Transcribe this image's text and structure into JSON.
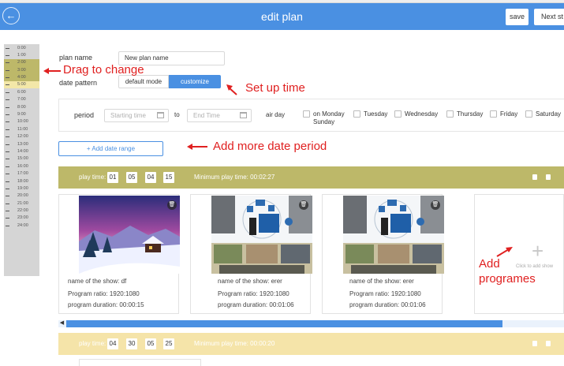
{
  "header": {
    "title": "edit plan",
    "save_label": "save",
    "next_label": "Next st"
  },
  "timeline": {
    "hours": [
      "0:00",
      "1:00",
      "2:00",
      "3:00",
      "4:00",
      "5:00",
      "6:00",
      "7:00",
      "8:00",
      "9:00",
      "10:00",
      "11:00",
      "12:00",
      "13:00",
      "14:00",
      "15:00",
      "16:00",
      "17:00",
      "18:00",
      "19:00",
      "20:00",
      "21:00",
      "22:00",
      "23:00",
      "24:00"
    ],
    "selected_range": "2:00-4:00",
    "current_hour": "5:00"
  },
  "form": {
    "plan_name_label": "plan name",
    "plan_name_value": "New plan name",
    "date_pattern_label": "date pattern",
    "default_mode_label": "default mode",
    "customize_label": "customize",
    "period_label": "period",
    "start_placeholder": "Starting time",
    "to_label": "to",
    "end_placeholder": "End Time",
    "air_day_label": "air day",
    "days": [
      "on Monday",
      "Sunday",
      "Tuesday",
      "Wednesday",
      "Thursday",
      "Friday",
      "Saturday"
    ],
    "add_date_range_label": "+ Add date range"
  },
  "annotations": {
    "drag": "Drag to change",
    "setup": "Set up time",
    "add_period": "Add more date period",
    "add_programes": "Add\nprogrames"
  },
  "playtimes": [
    {
      "label": "play time:",
      "values": [
        "01",
        "05",
        "04",
        "15"
      ],
      "min_label": "Minimum play time:",
      "min_value": "00:02:27",
      "shows": [
        {
          "name_label": "name of the show:",
          "name": "df",
          "ratio_label": "Program ratio:",
          "ratio": "1920:1080",
          "duration_label": "program duration:",
          "duration": "00:00:15",
          "thumb": "winter-snow-cabin"
        },
        {
          "name_label": "name of the show:",
          "name": "erer",
          "ratio_label": "Program ratio:",
          "ratio": "1920:1080",
          "duration_label": "program duration:",
          "duration": "00:01:06",
          "thumb": "smart-home-diagram"
        },
        {
          "name_label": "name of the show:",
          "name": "erer",
          "ratio_label": "Program ratio:",
          "ratio": "1920:1080",
          "duration_label": "program duration:",
          "duration": "00:01:06",
          "thumb": "smart-home-diagram"
        }
      ],
      "add_show_label": "Click to add show"
    },
    {
      "label": "play time:",
      "values": [
        "04",
        "30",
        "05",
        "25"
      ],
      "min_label": "Minimum play time:",
      "min_value": "00:00:20"
    }
  ],
  "colors": {
    "accent": "#4a90e2",
    "annotation": "#e02020",
    "olive": "#bdb869",
    "pale": "#f5e4a9"
  }
}
